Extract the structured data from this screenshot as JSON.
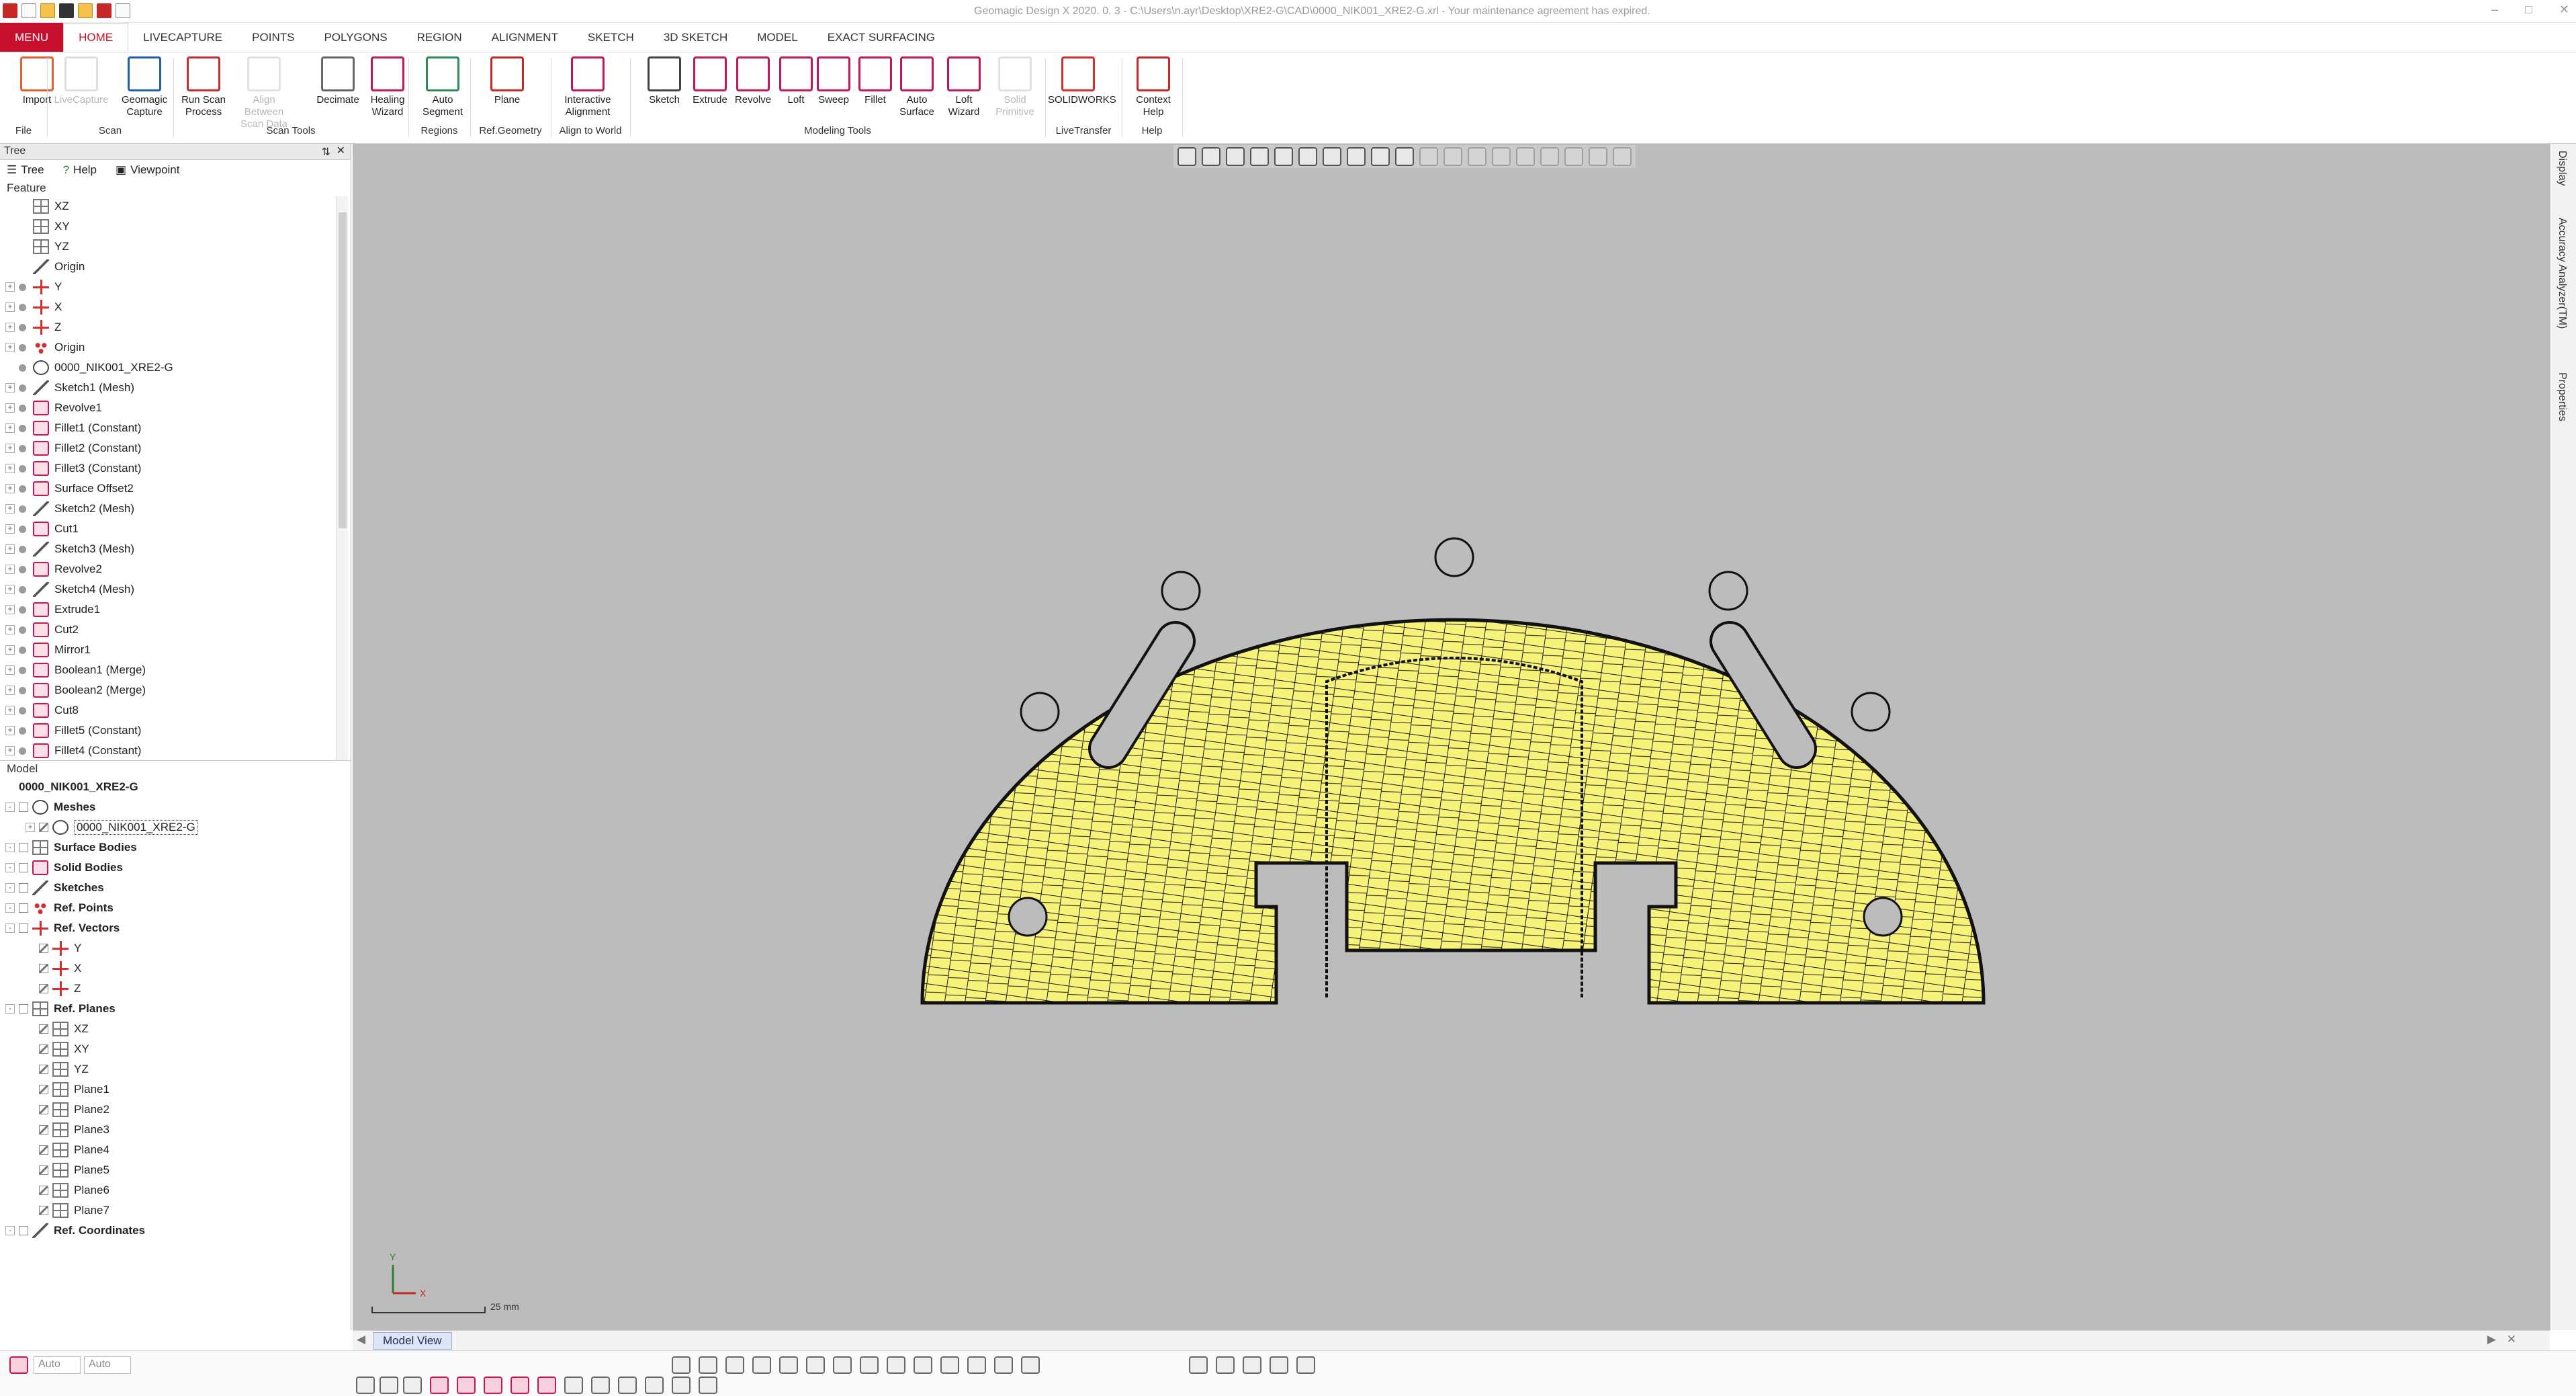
{
  "app": {
    "title": "Geomagic Design X 2020. 0. 3 - C:\\Users\\n.ayr\\Desktop\\XRE2-G\\CAD\\0000_NIK001_XRE2-G.xrl - Your maintenance agreement has expired.",
    "tabs": [
      "MENU",
      "HOME",
      "LIVECAPTURE",
      "POINTS",
      "POLYGONS",
      "REGION",
      "ALIGNMENT",
      "SKETCH",
      "3D SKETCH",
      "MODEL",
      "EXACT SURFACING"
    ]
  },
  "ribbon": {
    "buttons": [
      {
        "l1": "Import",
        "l2": "",
        "disabled": false
      },
      {
        "l1": "LiveCapture",
        "l2": "",
        "disabled": true
      },
      {
        "l1": "Geomagic",
        "l2": "Capture",
        "disabled": false
      },
      {
        "l1": "Run Scan",
        "l2": "Process",
        "disabled": false
      },
      {
        "l1": "Align Between",
        "l2": "Scan Data",
        "disabled": true
      },
      {
        "l1": "Decimate",
        "l2": "",
        "disabled": false
      },
      {
        "l1": "Healing",
        "l2": "Wizard",
        "disabled": false
      },
      {
        "l1": "Auto",
        "l2": "Segment",
        "disabled": false
      },
      {
        "l1": "Plane",
        "l2": "",
        "disabled": false
      },
      {
        "l1": "Interactive",
        "l2": "Alignment",
        "disabled": false
      },
      {
        "l1": "Sketch",
        "l2": "",
        "disabled": false
      },
      {
        "l1": "Extrude",
        "l2": "",
        "disabled": false
      },
      {
        "l1": "Revolve",
        "l2": "",
        "disabled": false
      },
      {
        "l1": "Loft",
        "l2": "",
        "disabled": false
      },
      {
        "l1": "Sweep",
        "l2": "",
        "disabled": false
      },
      {
        "l1": "Fillet",
        "l2": "",
        "disabled": false
      },
      {
        "l1": "Auto",
        "l2": "Surface",
        "disabled": false
      },
      {
        "l1": "Loft",
        "l2": "Wizard",
        "disabled": false
      },
      {
        "l1": "Solid",
        "l2": "Primitive",
        "disabled": true
      },
      {
        "l1": "SOLIDWORKS",
        "l2": "",
        "disabled": false
      },
      {
        "l1": "Context",
        "l2": "Help",
        "disabled": false
      }
    ],
    "groups": [
      "File",
      "Scan",
      "Scan Tools",
      "Regions",
      "Ref.Geometry",
      "Align to World",
      "Modeling Tools",
      "LiveTransfer",
      "Help"
    ]
  },
  "panel": {
    "title": "Tree",
    "tabs": [
      "Tree",
      "Help",
      "Viewpoint"
    ],
    "feature_label": "Feature",
    "model_label": "Model",
    "features": [
      {
        "label": "XZ",
        "icon": "plane",
        "exp": false,
        "dot": false
      },
      {
        "label": "XY",
        "icon": "plane",
        "exp": false,
        "dot": false
      },
      {
        "label": "YZ",
        "icon": "plane",
        "exp": false,
        "dot": false
      },
      {
        "label": "Origin",
        "icon": "sk",
        "exp": false,
        "dot": false
      },
      {
        "label": "Y",
        "icon": "ax",
        "exp": true,
        "dot": true
      },
      {
        "label": "X",
        "icon": "ax",
        "exp": true,
        "dot": true
      },
      {
        "label": "Z",
        "icon": "ax",
        "exp": true,
        "dot": true
      },
      {
        "label": "Origin",
        "icon": "org",
        "exp": true,
        "dot": true
      },
      {
        "label": "0000_NIK001_XRE2-G",
        "icon": "mesh",
        "exp": false,
        "dot": true
      },
      {
        "label": "Sketch1 (Mesh)",
        "icon": "sk",
        "exp": true,
        "dot": true
      },
      {
        "label": "Revolve1",
        "icon": "red",
        "exp": true,
        "dot": true
      },
      {
        "label": "Fillet1 (Constant)",
        "icon": "red",
        "exp": true,
        "dot": true
      },
      {
        "label": "Fillet2 (Constant)",
        "icon": "red",
        "exp": true,
        "dot": true
      },
      {
        "label": "Fillet3 (Constant)",
        "icon": "red",
        "exp": true,
        "dot": true
      },
      {
        "label": "Surface Offset2",
        "icon": "red",
        "exp": true,
        "dot": true
      },
      {
        "label": "Sketch2 (Mesh)",
        "icon": "sk",
        "exp": true,
        "dot": true
      },
      {
        "label": "Cut1",
        "icon": "red",
        "exp": true,
        "dot": true
      },
      {
        "label": "Sketch3 (Mesh)",
        "icon": "sk",
        "exp": true,
        "dot": true
      },
      {
        "label": "Revolve2",
        "icon": "red",
        "exp": true,
        "dot": true
      },
      {
        "label": "Sketch4 (Mesh)",
        "icon": "sk",
        "exp": true,
        "dot": true
      },
      {
        "label": "Extrude1",
        "icon": "red",
        "exp": true,
        "dot": true
      },
      {
        "label": "Cut2",
        "icon": "red",
        "exp": true,
        "dot": true
      },
      {
        "label": "Mirror1",
        "icon": "red",
        "exp": true,
        "dot": true
      },
      {
        "label": "Boolean1 (Merge)",
        "icon": "red",
        "exp": true,
        "dot": true
      },
      {
        "label": "Boolean2 (Merge)",
        "icon": "red",
        "exp": true,
        "dot": true
      },
      {
        "label": "Cut8",
        "icon": "red",
        "exp": true,
        "dot": true
      },
      {
        "label": "Fillet5 (Constant)",
        "icon": "red",
        "exp": true,
        "dot": true
      },
      {
        "label": "Fillet4 (Constant)",
        "icon": "red",
        "exp": true,
        "dot": true
      }
    ],
    "model": [
      {
        "label": "0000_NIK001_XRE2-G",
        "bold": true,
        "indent": 0,
        "icon": "none",
        "exp": false,
        "chk": false
      },
      {
        "label": "Meshes",
        "bold": true,
        "indent": 0,
        "icon": "mesh",
        "exp": true,
        "chk": true
      },
      {
        "label": "0000_NIK001_XRE2-G",
        "bold": false,
        "indent": 1,
        "icon": "mesh",
        "exp": true,
        "chk": true,
        "selected": true
      },
      {
        "label": "Surface Bodies",
        "bold": true,
        "indent": 0,
        "icon": "plane",
        "exp": true,
        "chk": true
      },
      {
        "label": "Solid Bodies",
        "bold": true,
        "indent": 0,
        "icon": "red",
        "exp": true,
        "chk": true
      },
      {
        "label": "Sketches",
        "bold": true,
        "indent": 0,
        "icon": "sk",
        "exp": true,
        "chk": true
      },
      {
        "label": "Ref. Points",
        "bold": true,
        "indent": 0,
        "icon": "org",
        "exp": true,
        "chk": true
      },
      {
        "label": "Ref. Vectors",
        "bold": true,
        "indent": 0,
        "icon": "ax",
        "exp": true,
        "chk": true
      },
      {
        "label": "Y",
        "bold": false,
        "indent": 1,
        "icon": "ax",
        "exp": false,
        "chk": true
      },
      {
        "label": "X",
        "bold": false,
        "indent": 1,
        "icon": "ax",
        "exp": false,
        "chk": true
      },
      {
        "label": "Z",
        "bold": false,
        "indent": 1,
        "icon": "ax",
        "exp": false,
        "chk": true
      },
      {
        "label": "Ref. Planes",
        "bold": true,
        "indent": 0,
        "icon": "plane",
        "exp": true,
        "chk": true
      },
      {
        "label": "XZ",
        "bold": false,
        "indent": 1,
        "icon": "plane",
        "exp": false,
        "chk": true
      },
      {
        "label": "XY",
        "bold": false,
        "indent": 1,
        "icon": "plane",
        "exp": false,
        "chk": true
      },
      {
        "label": "YZ",
        "bold": false,
        "indent": 1,
        "icon": "plane",
        "exp": false,
        "chk": true
      },
      {
        "label": "Plane1",
        "bold": false,
        "indent": 1,
        "icon": "plane",
        "exp": false,
        "chk": true
      },
      {
        "label": "Plane2",
        "bold": false,
        "indent": 1,
        "icon": "plane",
        "exp": false,
        "chk": true
      },
      {
        "label": "Plane3",
        "bold": false,
        "indent": 1,
        "icon": "plane",
        "exp": false,
        "chk": true
      },
      {
        "label": "Plane4",
        "bold": false,
        "indent": 1,
        "icon": "plane",
        "exp": false,
        "chk": true
      },
      {
        "label": "Plane5",
        "bold": false,
        "indent": 1,
        "icon": "plane",
        "exp": false,
        "chk": true
      },
      {
        "label": "Plane6",
        "bold": false,
        "indent": 1,
        "icon": "plane",
        "exp": false,
        "chk": true
      },
      {
        "label": "Plane7",
        "bold": false,
        "indent": 1,
        "icon": "plane",
        "exp": false,
        "chk": true
      },
      {
        "label": "Ref. Coordinates",
        "bold": true,
        "indent": 0,
        "icon": "sk",
        "exp": true,
        "chk": true
      }
    ]
  },
  "viewport": {
    "scale_label": "25 mm",
    "axis_x": "X",
    "axis_y": "Y",
    "mesh_color": "#f6f27a",
    "background": "#bcbcbc"
  },
  "right_tabs": [
    "Display",
    "Accuracy Analyzer(TM)",
    "Properties"
  ],
  "view_tab": {
    "label": "Model View"
  },
  "status": {
    "dd1": "Auto",
    "dd2": "Auto"
  },
  "colors": {
    "accent": "#c8102e",
    "mesh_fill": "#f6f27a",
    "mesh_line": "#1a1a1a"
  }
}
